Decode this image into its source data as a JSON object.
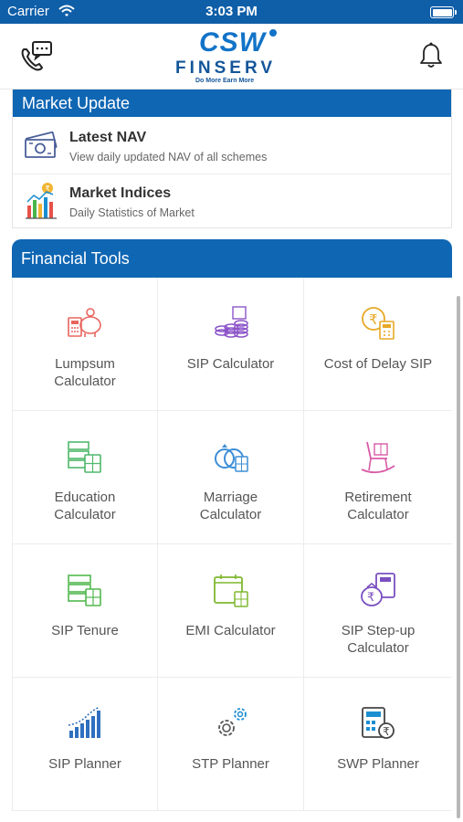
{
  "status_bar": {
    "carrier": "Carrier",
    "time": "3:03 PM"
  },
  "header": {
    "logo": {
      "brand": "CSW",
      "name": "FINSERV",
      "tagline": "Do More Earn More"
    },
    "icons": [
      "call-chat-icon",
      "bell-icon"
    ]
  },
  "market_update": {
    "title": "Market Update",
    "items": [
      {
        "title": "Latest NAV",
        "subtitle": "View daily updated NAV of all schemes",
        "icon": "nav-money-icon"
      },
      {
        "title": "Market Indices",
        "subtitle": "Daily Statistics of Market",
        "icon": "market-chart-icon"
      }
    ]
  },
  "financial_tools": {
    "title": "Financial Tools",
    "items": [
      {
        "label": "Lumpsum\nCalculator",
        "icon": "piggy-bank-calculator-icon"
      },
      {
        "label": "SIP Calculator",
        "icon": "coins-stack-icon"
      },
      {
        "label": "Cost of Delay SIP",
        "icon": "rupee-clock-icon"
      },
      {
        "label": "Education\nCalculator",
        "icon": "education-calculator-icon"
      },
      {
        "label": "Marriage\nCalculator",
        "icon": "rings-icon"
      },
      {
        "label": "Retirement\nCalculator",
        "icon": "rocking-chair-icon"
      },
      {
        "label": "SIP Tenure",
        "icon": "sip-tenure-icon"
      },
      {
        "label": "EMI Calculator",
        "icon": "calendar-calculator-icon"
      },
      {
        "label": "SIP Step-up\nCalculator",
        "icon": "money-bag-calculator-icon"
      },
      {
        "label": "SIP Planner",
        "icon": "growth-bars-icon"
      },
      {
        "label": "STP Planner",
        "icon": "gears-icon"
      },
      {
        "label": "SWP Planner",
        "icon": "rupee-calculator-icon"
      }
    ]
  },
  "colors": {
    "brand_blue": "#0f66b3",
    "status_blue": "#0f5ea8"
  }
}
